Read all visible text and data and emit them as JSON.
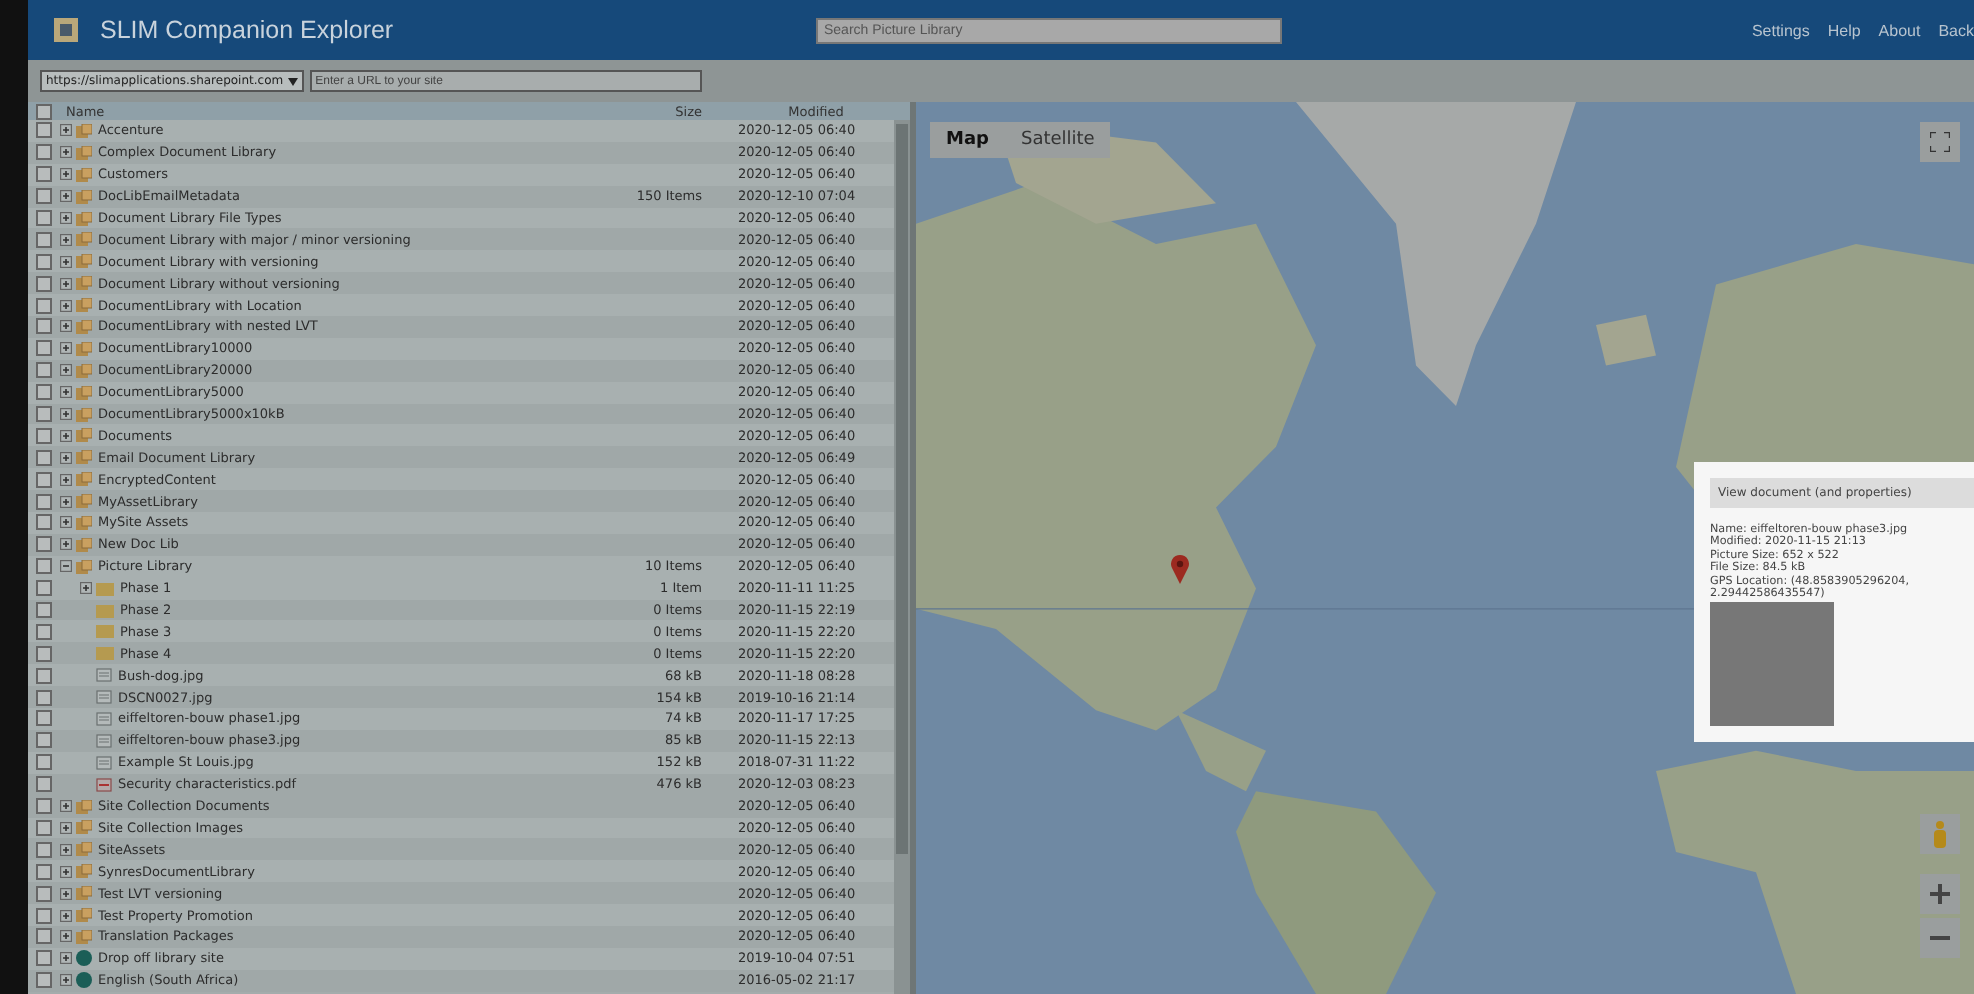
{
  "app": {
    "title": "SLIM Companion Explorer",
    "search": {
      "placeholder": "Search Picture Library"
    },
    "nav": [
      "Settings",
      "Help",
      "About",
      "Back"
    ]
  },
  "address": {
    "site": "https://slimapplications.sharepoint.com",
    "url_field": {
      "placeholder": "Enter a URL to your site"
    }
  },
  "table": {
    "columns": [
      "Name",
      "Size",
      "Modified"
    ],
    "all_checked": false,
    "rows": [
      {
        "kind": "library",
        "name": "Accenture",
        "size": "",
        "modified": "2020-12-05 06:40",
        "checked": false,
        "expanded": false
      },
      {
        "kind": "library",
        "name": "Complex Document Library",
        "size": "",
        "modified": "2020-12-05 06:40",
        "checked": false,
        "expanded": false
      },
      {
        "kind": "library",
        "name": "Customers",
        "size": "",
        "modified": "2020-12-05 06:40",
        "checked": false,
        "expanded": false
      },
      {
        "kind": "library",
        "name": "DocLibEmailMetadata",
        "size": "150 Items",
        "modified": "2020-12-10 07:04",
        "checked": false,
        "expanded": false
      },
      {
        "kind": "library",
        "name": "Document Library File Types",
        "size": "",
        "modified": "2020-12-05 06:40",
        "checked": false,
        "expanded": false
      },
      {
        "kind": "library",
        "name": "Document Library with major / minor versioning",
        "size": "",
        "modified": "2020-12-05 06:40",
        "checked": false,
        "expanded": false
      },
      {
        "kind": "library",
        "name": "Document Library with versioning",
        "size": "",
        "modified": "2020-12-05 06:40",
        "checked": false,
        "expanded": false
      },
      {
        "kind": "library",
        "name": "Document Library without versioning",
        "size": "",
        "modified": "2020-12-05 06:40",
        "checked": false,
        "expanded": false
      },
      {
        "kind": "library",
        "name": "DocumentLibrary with Location",
        "size": "",
        "modified": "2020-12-05 06:40",
        "checked": false,
        "expanded": false
      },
      {
        "kind": "library",
        "name": "DocumentLibrary with nested LVT",
        "size": "",
        "modified": "2020-12-05 06:40",
        "checked": false,
        "expanded": false
      },
      {
        "kind": "library",
        "name": "DocumentLibrary10000",
        "size": "",
        "modified": "2020-12-05 06:40",
        "checked": false,
        "expanded": false
      },
      {
        "kind": "library",
        "name": "DocumentLibrary20000",
        "size": "",
        "modified": "2020-12-05 06:40",
        "checked": false,
        "expanded": false
      },
      {
        "kind": "library",
        "name": "DocumentLibrary5000",
        "size": "",
        "modified": "2020-12-05 06:40",
        "checked": false,
        "expanded": false
      },
      {
        "kind": "library",
        "name": "DocumentLibrary5000x10kB",
        "size": "",
        "modified": "2020-12-05 06:40",
        "checked": false,
        "expanded": false
      },
      {
        "kind": "library",
        "name": "Documents",
        "size": "",
        "modified": "2020-12-05 06:40",
        "checked": false,
        "expanded": false
      },
      {
        "kind": "library",
        "name": "Email Document Library",
        "size": "",
        "modified": "2020-12-05 06:49",
        "checked": false,
        "expanded": false
      },
      {
        "kind": "library",
        "name": "EncryptedContent",
        "size": "",
        "modified": "2020-12-05 06:40",
        "checked": false,
        "expanded": false
      },
      {
        "kind": "library",
        "name": "MyAssetLibrary",
        "size": "",
        "modified": "2020-12-05 06:40",
        "checked": false,
        "expanded": false
      },
      {
        "kind": "library",
        "name": "MySite Assets",
        "size": "",
        "modified": "2020-12-05 06:40",
        "checked": false,
        "expanded": false
      },
      {
        "kind": "library",
        "name": "New Doc Lib",
        "size": "",
        "modified": "2020-12-05 06:40",
        "checked": false,
        "expanded": false
      },
      {
        "kind": "library",
        "name": "Picture Library",
        "size": "10 Items",
        "modified": "2020-12-05 06:40",
        "checked": false,
        "expanded": true,
        "children": [
          {
            "kind": "folder",
            "name": "Phase 1",
            "size": "1 Item",
            "modified": "2020-11-11 11:25",
            "checked": false,
            "expanded": false
          },
          {
            "kind": "folder",
            "name": "Phase 2",
            "size": "0 Items",
            "modified": "2020-11-15 22:19",
            "checked": false
          },
          {
            "kind": "folder",
            "name": "Phase 3",
            "size": "0 Items",
            "modified": "2020-11-15 22:20",
            "checked": false
          },
          {
            "kind": "folder",
            "name": "Phase 4",
            "size": "0 Items",
            "modified": "2020-11-15 22:20",
            "checked": false
          },
          {
            "kind": "image",
            "name": "Bush-dog.jpg",
            "size": "68 kB",
            "modified": "2020-11-18 08:28",
            "checked": false
          },
          {
            "kind": "image",
            "name": "DSCN0027.jpg",
            "size": "154 kB",
            "modified": "2019-10-16 21:14",
            "checked": false
          },
          {
            "kind": "image",
            "name": "eiffeltoren-bouw phase1.jpg",
            "size": "74 kB",
            "modified": "2020-11-17 17:25",
            "checked": false
          },
          {
            "kind": "image",
            "name": "eiffeltoren-bouw phase3.jpg",
            "size": "85 kB",
            "modified": "2020-11-15 22:13",
            "checked": false
          },
          {
            "kind": "image",
            "name": "Example St Louis.jpg",
            "size": "152 kB",
            "modified": "2018-07-31 11:22",
            "checked": false
          },
          {
            "kind": "pdf",
            "name": "Security characteristics.pdf",
            "size": "476 kB",
            "modified": "2020-12-03 08:23",
            "checked": false
          }
        ]
      },
      {
        "kind": "library",
        "name": "Site Collection Documents",
        "size": "",
        "modified": "2020-12-05 06:40",
        "checked": false,
        "expanded": false
      },
      {
        "kind": "library",
        "name": "Site Collection Images",
        "size": "",
        "modified": "2020-12-05 06:40",
        "checked": false,
        "expanded": false
      },
      {
        "kind": "library",
        "name": "SiteAssets",
        "size": "",
        "modified": "2020-12-05 06:40",
        "checked": false,
        "expanded": false
      },
      {
        "kind": "library",
        "name": "SynresDocumentLibrary",
        "size": "",
        "modified": "2020-12-05 06:40",
        "checked": false,
        "expanded": false
      },
      {
        "kind": "library",
        "name": "Test LVT versioning",
        "size": "",
        "modified": "2020-12-05 06:40",
        "checked": false,
        "expanded": false
      },
      {
        "kind": "library",
        "name": "Test Property Promotion",
        "size": "",
        "modified": "2020-12-05 06:40",
        "checked": false,
        "expanded": false
      },
      {
        "kind": "library",
        "name": "Translation Packages",
        "size": "",
        "modified": "2020-12-05 06:40",
        "checked": false,
        "expanded": false
      },
      {
        "kind": "site",
        "name": "Drop off library site",
        "size": "",
        "modified": "2019-10-04 07:51",
        "checked": false,
        "expanded": false
      },
      {
        "kind": "site",
        "name": "English (South Africa)",
        "size": "",
        "modified": "2016-05-02 21:17",
        "checked": false,
        "expanded": false
      }
    ]
  },
  "map": {
    "map_types": [
      {
        "label": "Map",
        "selected": true
      },
      {
        "label": "Satellite",
        "selected": false
      }
    ]
  },
  "popup": {
    "title": "View document (and properties)",
    "lines": [
      "Name: eiffeltoren-bouw phase3.jpg",
      "Modified: 2020-11-15 21:13",
      "Picture Size: 652 x 522",
      "File Size: 84.5 kB",
      "GPS Location: (48.8583905296204,",
      "2.29442586435547)"
    ]
  }
}
